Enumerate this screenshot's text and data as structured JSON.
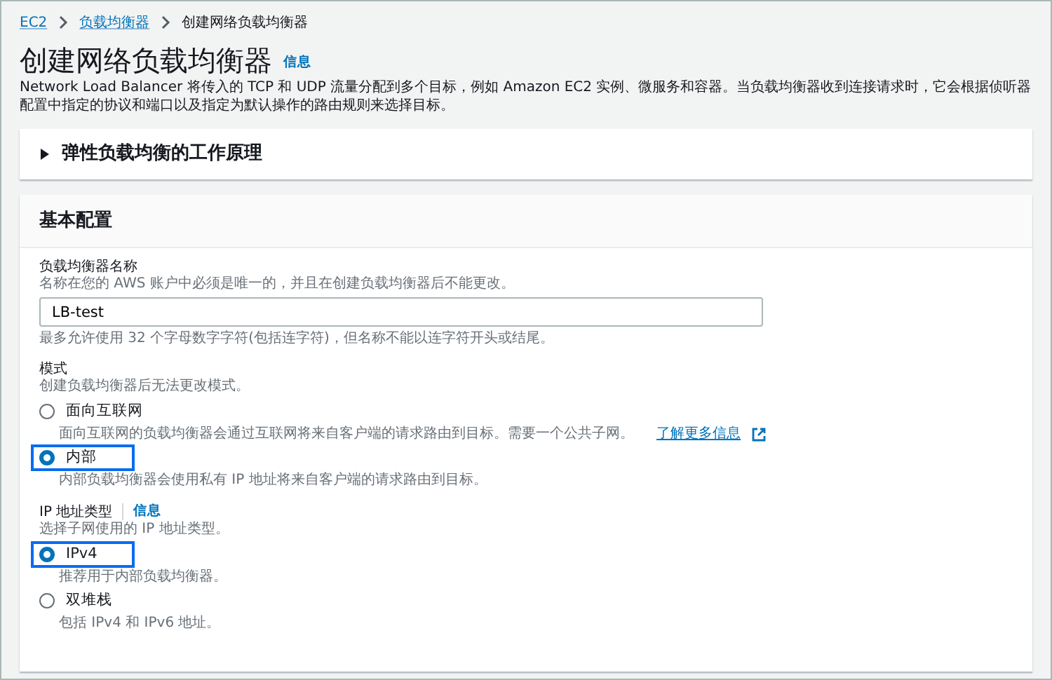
{
  "breadcrumb": [
    {
      "label": "EC2",
      "kind": "link"
    },
    {
      "label": "负载均衡器",
      "kind": "link"
    },
    {
      "label": "创建网络负载均衡器",
      "kind": "current"
    }
  ],
  "header": {
    "title": "创建网络负载均衡器",
    "info_link": "信息",
    "description": "Network Load Balancer 将传入的 TCP 和 UDP 流量分配到多个目标，例如 Amazon EC2 实例、微服务和容器。当负载均衡器收到连接请求时，它会根据侦听器配置中指定的协议和端口以及指定为默认操作的路由规则来选择目标。"
  },
  "expander": {
    "label": "弹性负载均衡的工作原理",
    "expanded": false
  },
  "section": {
    "title": "基本配置",
    "fields": [
      {
        "kind": "text",
        "label": "负载均衡器名称",
        "description": "名称在您的 AWS 账户中必须是唯一的，并且在创建负载均衡器后不能更改。",
        "value": "LB-test",
        "constraint": "最多允许使用 32 个字母数字字符(包括连字符)，但名称不能以连字符开头或结尾。"
      },
      {
        "kind": "radio",
        "label": "模式",
        "description": "创建负载均衡器后无法更改模式。",
        "options": [
          {
            "label": "面向互联网",
            "description": "面向互联网的负载均衡器会通过互联网将来自客户端的请求路由到目标。需要一个公共子网。",
            "link": "了解更多信息",
            "selected": false,
            "highlighted": false
          },
          {
            "label": "内部",
            "description": "内部负载均衡器会使用私有 IP 地址将来自客户端的请求路由到目标。",
            "selected": true,
            "highlighted": true
          }
        ]
      },
      {
        "kind": "radio",
        "label": "IP 地址类型",
        "info_link": "信息",
        "description": "选择子网使用的 IP 地址类型。",
        "options": [
          {
            "label": "IPv4",
            "description": "推荐用于内部负载均衡器。",
            "selected": true,
            "highlighted": true
          },
          {
            "label": "双堆栈",
            "description": "包括 IPv4 和 IPv6 地址。",
            "selected": false,
            "highlighted": false
          }
        ]
      }
    ]
  }
}
